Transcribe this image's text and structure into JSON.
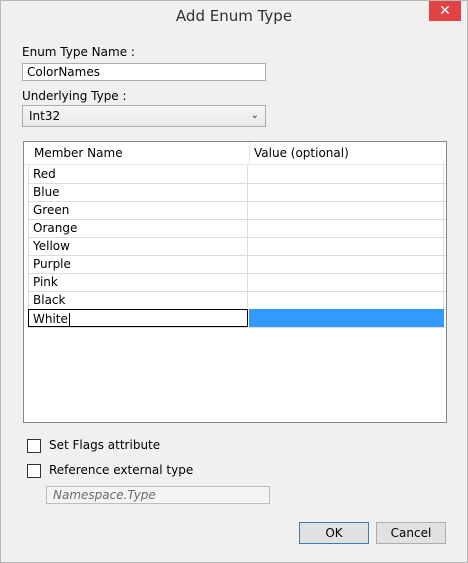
{
  "window": {
    "title": "Add Enum Type",
    "close_label": "✕"
  },
  "form": {
    "name_label": "Enum Type Name :",
    "name_value": "ColorNames",
    "underlying_label": "Underlying Type :",
    "underlying_value": "Int32",
    "chevron_icon": "chevron-down-icon"
  },
  "grid": {
    "columns": [
      "Member Name",
      "Value (optional)"
    ],
    "rows": [
      {
        "name": "Red",
        "value": ""
      },
      {
        "name": "Blue",
        "value": ""
      },
      {
        "name": "Green",
        "value": ""
      },
      {
        "name": "Orange",
        "value": ""
      },
      {
        "name": "Yellow",
        "value": ""
      },
      {
        "name": "Purple",
        "value": ""
      },
      {
        "name": "Pink",
        "value": ""
      },
      {
        "name": "Black",
        "value": ""
      },
      {
        "name": "White",
        "value": ""
      }
    ],
    "selection_color": "#3399ff"
  },
  "options": {
    "flags_label": "Set Flags attribute",
    "flags_checked": false,
    "external_label": "Reference external type",
    "external_checked": false,
    "namespace_placeholder": "Namespace.Type"
  },
  "buttons": {
    "ok": "OK",
    "cancel": "Cancel"
  },
  "colors": {
    "close_button": "#e04343",
    "dialog_bg": "#f0f0f0"
  }
}
